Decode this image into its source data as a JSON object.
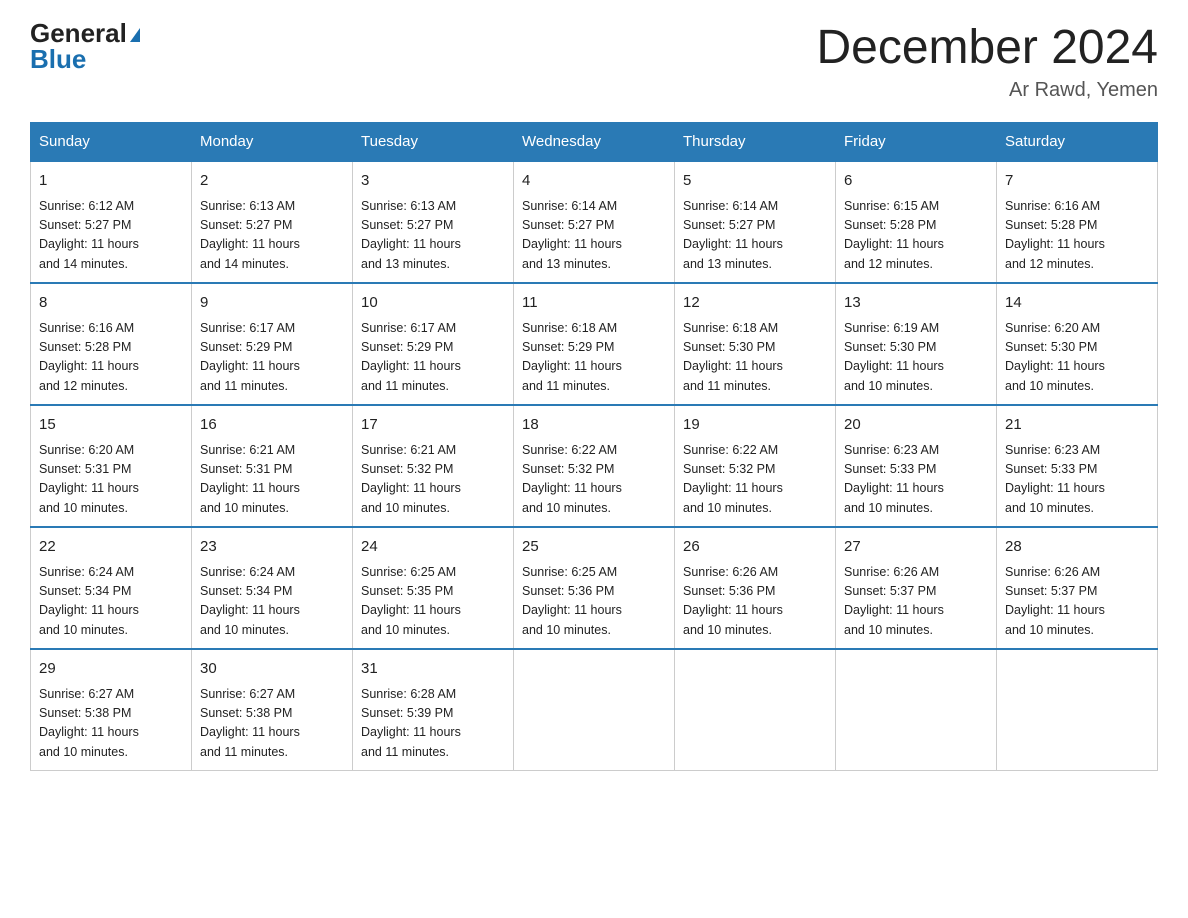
{
  "logo": {
    "general": "General",
    "blue": "Blue"
  },
  "title": "December 2024",
  "location": "Ar Rawd, Yemen",
  "days_of_week": [
    "Sunday",
    "Monday",
    "Tuesday",
    "Wednesday",
    "Thursday",
    "Friday",
    "Saturday"
  ],
  "weeks": [
    [
      {
        "day": "1",
        "info": "Sunrise: 6:12 AM\nSunset: 5:27 PM\nDaylight: 11 hours\nand 14 minutes."
      },
      {
        "day": "2",
        "info": "Sunrise: 6:13 AM\nSunset: 5:27 PM\nDaylight: 11 hours\nand 14 minutes."
      },
      {
        "day": "3",
        "info": "Sunrise: 6:13 AM\nSunset: 5:27 PM\nDaylight: 11 hours\nand 13 minutes."
      },
      {
        "day": "4",
        "info": "Sunrise: 6:14 AM\nSunset: 5:27 PM\nDaylight: 11 hours\nand 13 minutes."
      },
      {
        "day": "5",
        "info": "Sunrise: 6:14 AM\nSunset: 5:27 PM\nDaylight: 11 hours\nand 13 minutes."
      },
      {
        "day": "6",
        "info": "Sunrise: 6:15 AM\nSunset: 5:28 PM\nDaylight: 11 hours\nand 12 minutes."
      },
      {
        "day": "7",
        "info": "Sunrise: 6:16 AM\nSunset: 5:28 PM\nDaylight: 11 hours\nand 12 minutes."
      }
    ],
    [
      {
        "day": "8",
        "info": "Sunrise: 6:16 AM\nSunset: 5:28 PM\nDaylight: 11 hours\nand 12 minutes."
      },
      {
        "day": "9",
        "info": "Sunrise: 6:17 AM\nSunset: 5:29 PM\nDaylight: 11 hours\nand 11 minutes."
      },
      {
        "day": "10",
        "info": "Sunrise: 6:17 AM\nSunset: 5:29 PM\nDaylight: 11 hours\nand 11 minutes."
      },
      {
        "day": "11",
        "info": "Sunrise: 6:18 AM\nSunset: 5:29 PM\nDaylight: 11 hours\nand 11 minutes."
      },
      {
        "day": "12",
        "info": "Sunrise: 6:18 AM\nSunset: 5:30 PM\nDaylight: 11 hours\nand 11 minutes."
      },
      {
        "day": "13",
        "info": "Sunrise: 6:19 AM\nSunset: 5:30 PM\nDaylight: 11 hours\nand 10 minutes."
      },
      {
        "day": "14",
        "info": "Sunrise: 6:20 AM\nSunset: 5:30 PM\nDaylight: 11 hours\nand 10 minutes."
      }
    ],
    [
      {
        "day": "15",
        "info": "Sunrise: 6:20 AM\nSunset: 5:31 PM\nDaylight: 11 hours\nand 10 minutes."
      },
      {
        "day": "16",
        "info": "Sunrise: 6:21 AM\nSunset: 5:31 PM\nDaylight: 11 hours\nand 10 minutes."
      },
      {
        "day": "17",
        "info": "Sunrise: 6:21 AM\nSunset: 5:32 PM\nDaylight: 11 hours\nand 10 minutes."
      },
      {
        "day": "18",
        "info": "Sunrise: 6:22 AM\nSunset: 5:32 PM\nDaylight: 11 hours\nand 10 minutes."
      },
      {
        "day": "19",
        "info": "Sunrise: 6:22 AM\nSunset: 5:32 PM\nDaylight: 11 hours\nand 10 minutes."
      },
      {
        "day": "20",
        "info": "Sunrise: 6:23 AM\nSunset: 5:33 PM\nDaylight: 11 hours\nand 10 minutes."
      },
      {
        "day": "21",
        "info": "Sunrise: 6:23 AM\nSunset: 5:33 PM\nDaylight: 11 hours\nand 10 minutes."
      }
    ],
    [
      {
        "day": "22",
        "info": "Sunrise: 6:24 AM\nSunset: 5:34 PM\nDaylight: 11 hours\nand 10 minutes."
      },
      {
        "day": "23",
        "info": "Sunrise: 6:24 AM\nSunset: 5:34 PM\nDaylight: 11 hours\nand 10 minutes."
      },
      {
        "day": "24",
        "info": "Sunrise: 6:25 AM\nSunset: 5:35 PM\nDaylight: 11 hours\nand 10 minutes."
      },
      {
        "day": "25",
        "info": "Sunrise: 6:25 AM\nSunset: 5:36 PM\nDaylight: 11 hours\nand 10 minutes."
      },
      {
        "day": "26",
        "info": "Sunrise: 6:26 AM\nSunset: 5:36 PM\nDaylight: 11 hours\nand 10 minutes."
      },
      {
        "day": "27",
        "info": "Sunrise: 6:26 AM\nSunset: 5:37 PM\nDaylight: 11 hours\nand 10 minutes."
      },
      {
        "day": "28",
        "info": "Sunrise: 6:26 AM\nSunset: 5:37 PM\nDaylight: 11 hours\nand 10 minutes."
      }
    ],
    [
      {
        "day": "29",
        "info": "Sunrise: 6:27 AM\nSunset: 5:38 PM\nDaylight: 11 hours\nand 10 minutes."
      },
      {
        "day": "30",
        "info": "Sunrise: 6:27 AM\nSunset: 5:38 PM\nDaylight: 11 hours\nand 11 minutes."
      },
      {
        "day": "31",
        "info": "Sunrise: 6:28 AM\nSunset: 5:39 PM\nDaylight: 11 hours\nand 11 minutes."
      },
      {
        "day": "",
        "info": ""
      },
      {
        "day": "",
        "info": ""
      },
      {
        "day": "",
        "info": ""
      },
      {
        "day": "",
        "info": ""
      }
    ]
  ]
}
